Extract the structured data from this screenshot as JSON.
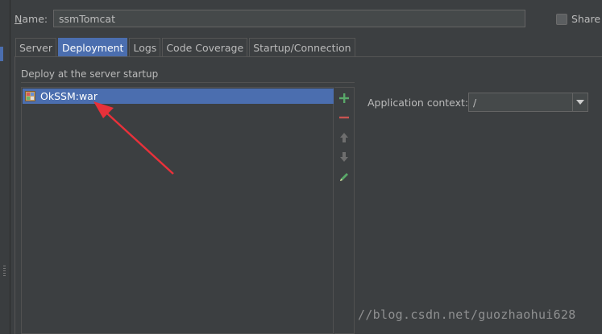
{
  "form": {
    "name_label_underlined": "N",
    "name_label_rest": "ame:",
    "name_value": "ssmTomcat",
    "share_label": "Share",
    "share_checked": false
  },
  "tabs": [
    {
      "label": "Server",
      "active": false
    },
    {
      "label": "Deployment",
      "active": true
    },
    {
      "label": "Logs",
      "active": false
    },
    {
      "label": "Code Coverage",
      "active": false
    },
    {
      "label": "Startup/Connection",
      "active": false
    }
  ],
  "deployment": {
    "section_title": "Deploy at the server startup",
    "artifacts": [
      {
        "label": "OkSSM:war",
        "icon": "war-artifact-icon",
        "selected": true
      }
    ],
    "toolbar": [
      "add-icon",
      "remove-icon",
      "move-up-icon",
      "move-down-icon",
      "edit-icon"
    ],
    "app_context_label": "Application context:",
    "app_context_value": "/"
  },
  "colors": {
    "selection": "#4b6eaf",
    "add": "#59a869",
    "remove": "#c75450",
    "annotation": "#e8313a"
  },
  "watermark": "//blog.csdn.net/guozhaohui628"
}
